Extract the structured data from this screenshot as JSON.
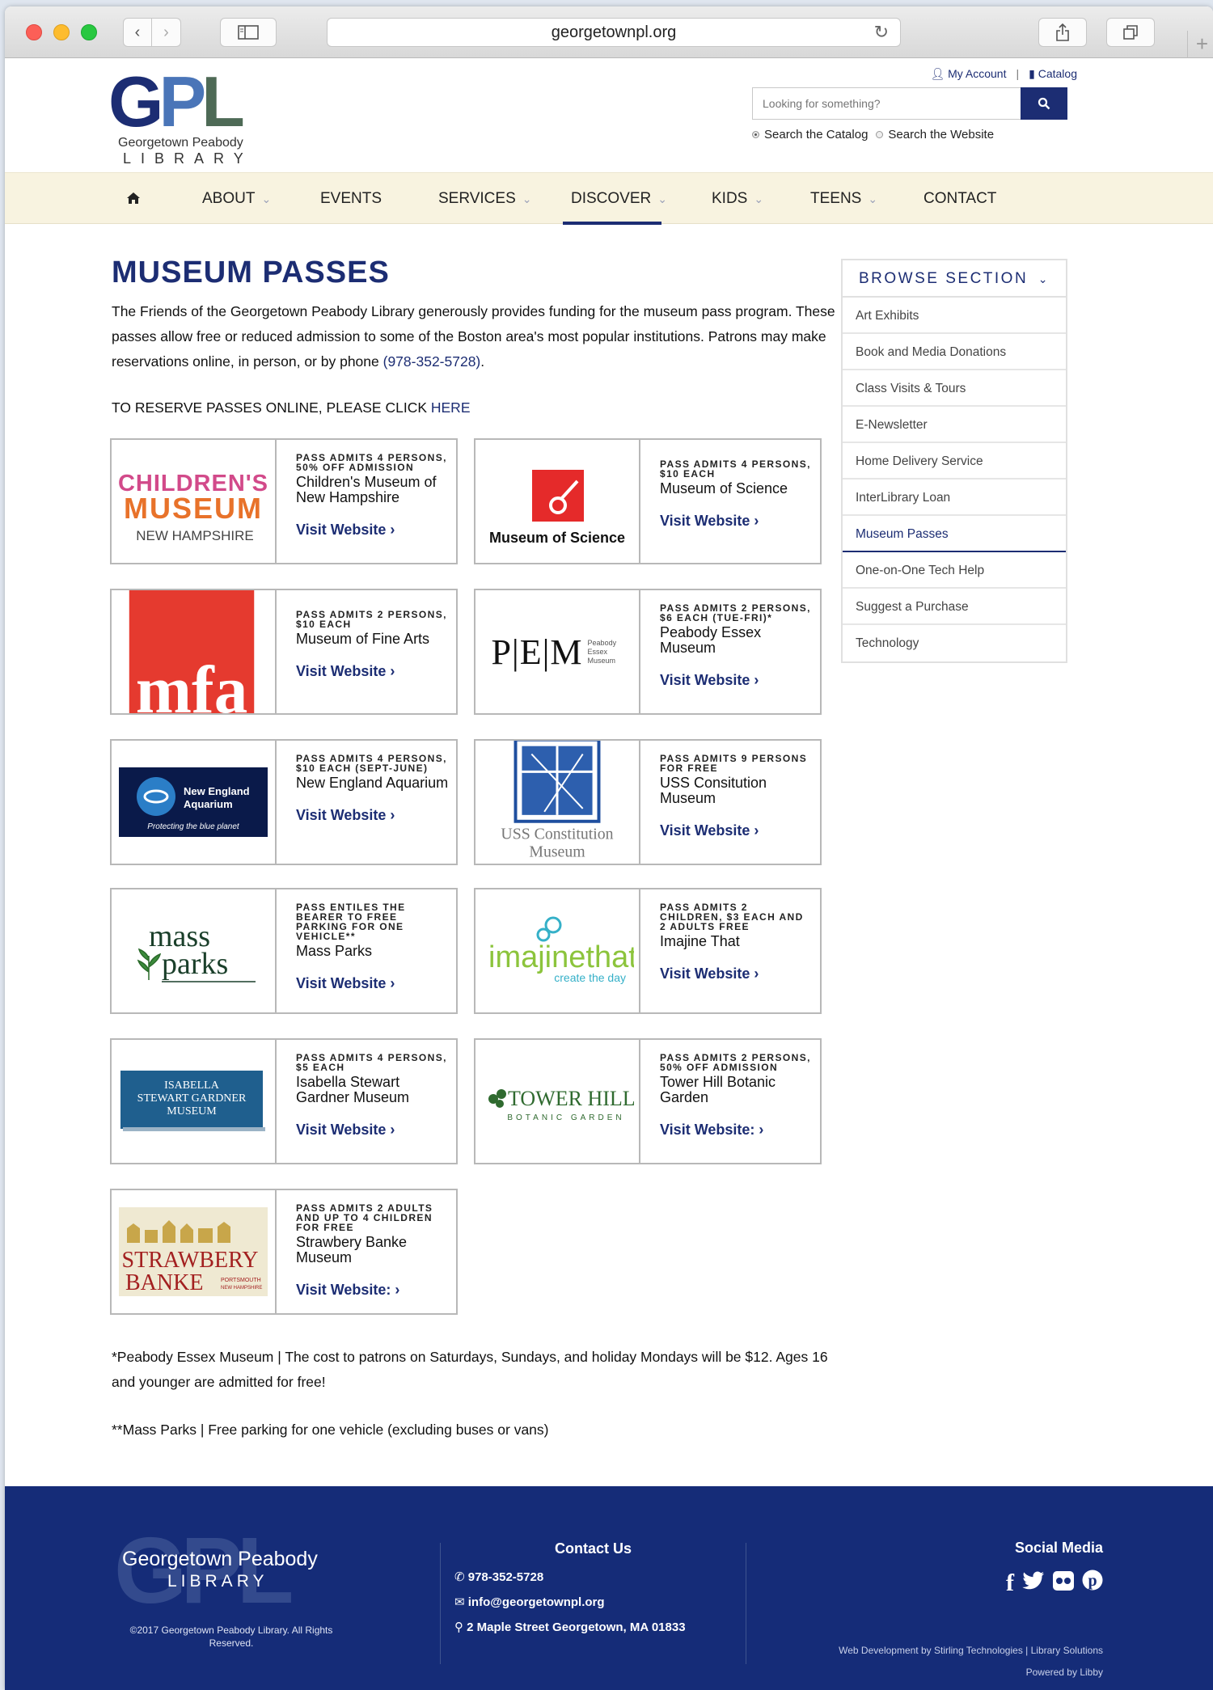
{
  "browser": {
    "url": "georgetownpl.org"
  },
  "header": {
    "logo_letters": "GPL",
    "logo_line1": "Georgetown Peabody",
    "logo_line2": "LIBRARY",
    "my_account": "My Account",
    "catalog": "Catalog",
    "search_placeholder": "Looking for something?",
    "radio_catalog": "Search the Catalog",
    "radio_website": "Search the Website"
  },
  "nav": {
    "home_icon": "home-icon",
    "items": [
      "ABOUT",
      "EVENTS",
      "SERVICES",
      "DISCOVER",
      "KIDS",
      "TEENS",
      "CONTACT"
    ],
    "active": "DISCOVER"
  },
  "main": {
    "title": "MUSEUM PASSES",
    "intro_1": "The Friends of the Georgetown Peabody Library generously provides funding for the museum pass program. These passes allow free or reduced admission to some of the Boston area's most popular institutions. Patrons may make reservations online, in person, or by phone ",
    "phone": "(978-352-5728)",
    "intro_end": ".",
    "reserve_text": "TO RESERVE PASSES ONLINE, PLEASE CLICK ",
    "reserve_link": "HERE",
    "passes": [
      {
        "logo": "CHILDREN'S MUSEUM",
        "logo_sub": "NEW HAMPSHIRE",
        "admits": "PASS ADMITS 4 PERSONS, 50% OFF ADMISSION",
        "name": "Children's Museum of New Hampshire",
        "link": "Visit Website"
      },
      {
        "logo": "Museum of Science",
        "logo_sub": "",
        "admits": "PASS ADMITS 4 PERSONS, $10 EACH",
        "name": "Museum of Science",
        "link": "Visit Website"
      },
      {
        "logo": "mfa",
        "logo_sub": "",
        "admits": "PASS ADMITS 2 PERSONS, $10 EACH",
        "name": "Museum of Fine Arts",
        "link": "Visit Website"
      },
      {
        "logo": "P|E|M",
        "logo_sub": "Peabody Essex Museum",
        "admits": "PASS ADMITS 2 PERSONS, $6 EACH (TUE-FRI)*",
        "name": "Peabody Essex Museum",
        "link": "Visit Website"
      },
      {
        "logo": "New England Aquarium",
        "logo_sub": "Protecting the blue planet",
        "admits": "PASS ADMITS 4 PERSONS, $10 EACH (SEPT-JUNE)",
        "name": "New England Aquarium",
        "link": "Visit Website"
      },
      {
        "logo": "USS Constitution Museum",
        "logo_sub": "",
        "admits": "PASS ADMITS 9 PERSONS FOR FREE",
        "name": "USS Consitution Museum",
        "link": "Visit Website"
      },
      {
        "logo": "mass parks",
        "logo_sub": "",
        "admits": "PASS ENTILES THE BEARER TO FREE PARKING FOR ONE VEHICLE**",
        "name": "Mass Parks",
        "link": "Visit Website"
      },
      {
        "logo": "imajinethat",
        "logo_sub": "create the day",
        "admits": "PASS ADMITS 2 CHILDREN, $3 EACH AND 2 ADULTS FREE",
        "name": "Imajine That",
        "link": "Visit Website"
      },
      {
        "logo": "ISABELLA STEWART GARDNER MUSEUM",
        "logo_sub": "",
        "admits": "PASS ADMITS 4 PERSONS, $5 EACH",
        "name": "Isabella Stewart Gardner Museum",
        "link": "Visit Website"
      },
      {
        "logo": "TOWER HILL",
        "logo_sub": "BOTANIC GARDEN",
        "admits": "PASS ADMITS 2 PERSONS, 50% OFF ADMISSION",
        "name": "Tower Hill Botanic Garden",
        "link": "Visit Website:"
      },
      {
        "logo": "STRAWBERY BANKE",
        "logo_sub": "PORTSMOUTH NEW HAMPSHIRE",
        "admits": "PASS ADMITS 2 ADULTS AND UP TO 4 CHILDREN FOR FREE",
        "name": "Strawbery Banke Museum",
        "link": "Visit Website:"
      }
    ],
    "note_1": "*Peabody Essex Museum | The cost to patrons on Saturdays, Sundays, and holiday Mondays will be $12. Ages 16 and younger are admitted for free!",
    "note_2": "**Mass Parks | Free parking for one vehicle (excluding buses or vans)"
  },
  "sidebar": {
    "heading": "BROWSE SECTION",
    "items": [
      "Art Exhibits",
      "Book and Media Donations",
      "Class Visits & Tours",
      "E-Newsletter",
      "Home Delivery Service",
      "InterLibrary Loan",
      "Museum Passes",
      "One-on-One Tech Help",
      "Suggest a Purchase",
      "Technology"
    ],
    "active": "Museum Passes"
  },
  "footer": {
    "logo_big": "GPL",
    "name_1": "Georgetown Peabody",
    "name_2": "LIBRARY",
    "copyright": "©2017 Georgetown Peabody Library. All Rights Reserved.",
    "contact_heading": "Contact Us",
    "phone": "978-352-5728",
    "email": "info@georgetownpl.org",
    "address": "2 Maple Street Georgetown, MA 01833",
    "social_heading": "Social Media",
    "credit_1": "Web Development by Stirling Technologies | Library Solutions",
    "credit_2": "Powered by Libby"
  }
}
